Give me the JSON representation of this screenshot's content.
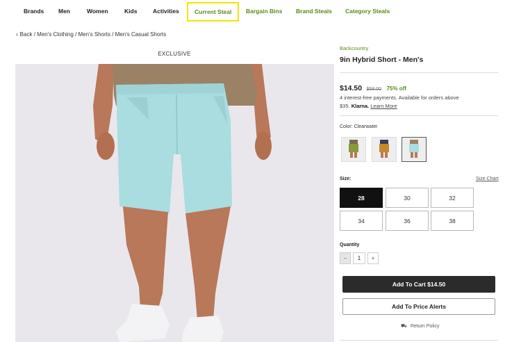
{
  "nav": {
    "items": [
      "Brands",
      "Men",
      "Women",
      "Kids",
      "Activities",
      "Current Steal",
      "Bargain Bins",
      "Brand Steals",
      "Category Steals"
    ]
  },
  "breadcrumb": {
    "back": "Back",
    "items": [
      "Men's Clothing",
      "Men's Shorts",
      "Men's Casual Shorts"
    ]
  },
  "product": {
    "badge": "EXCLUSIVE",
    "brand": "Backcountry",
    "title": "9in Hybrid Short - Men's",
    "price": "$14.50",
    "original_price": "$58.00",
    "discount": "75% off",
    "klarna_text": "4 interest-free payments. Available for orders above $35.",
    "klarna_brand": "Klarna.",
    "klarna_link": "Learn More",
    "color_label": "Color:",
    "color_value": "Clearwater",
    "size_label": "Size:",
    "size_chart": "Size Chart",
    "sizes": [
      "28",
      "30",
      "32",
      "34",
      "36",
      "38"
    ],
    "selected_size": "28",
    "quantity_label": "Quantity",
    "quantity": "1",
    "qty_minus": "−",
    "qty_plus": "+",
    "add_to_cart": "Add To Cart $14.50",
    "price_alerts": "Add To Price Alerts",
    "return_policy": "Return Policy"
  },
  "colors": {
    "accent_green": "#5a8a1a",
    "highlight_yellow": "#f0e800",
    "swatch_olive": "#8a9a3a",
    "swatch_orange": "#c48a2a",
    "swatch_clearwater": "#a9dde0"
  }
}
